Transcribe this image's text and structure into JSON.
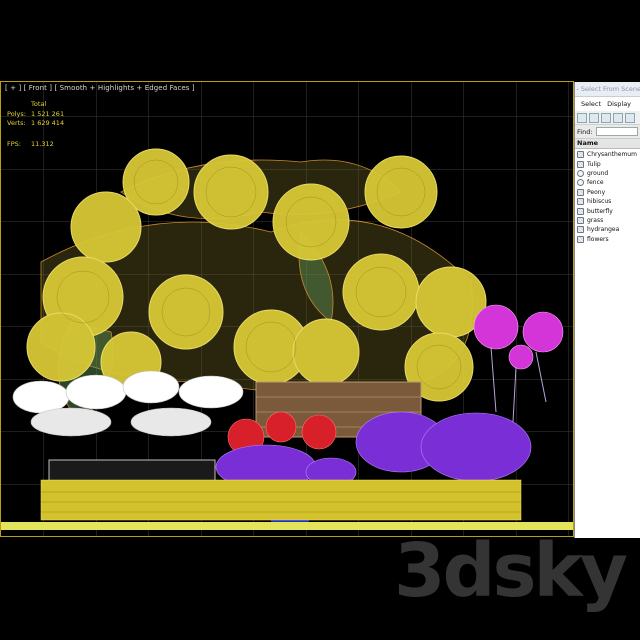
{
  "viewport": {
    "label": "[ + ] [ Front ] [ Smooth + Highlights + Edged Faces ]",
    "stats": {
      "total_label": "Total",
      "polys_label": "Polys:",
      "polys_value": "1 521 261",
      "verts_label": "Verts:",
      "verts_value": "1 629 414",
      "fps_label": "FPS:",
      "fps_value": "11.312"
    },
    "colors": {
      "frame": "#b8a012",
      "grid": "#3b3b3b",
      "hydrangea": "#d8c836",
      "leaf_wire": "#c8892a",
      "lily": "#ffffff",
      "peony": "#d8202a",
      "purple_flower": "#7a2fd6",
      "pink_chrysanthemum": "#d335d9",
      "grass": "#d3c22c",
      "ground": "#e4e45a"
    }
  },
  "panel": {
    "title": "Select From Scene",
    "menu": [
      "Select",
      "Display"
    ],
    "find_label": "Find:",
    "find_value": "",
    "column_name": "Name",
    "items": [
      {
        "label": "Chrysanthemum",
        "icon": "mesh"
      },
      {
        "label": "Tulip",
        "icon": "mesh"
      },
      {
        "label": "ground",
        "icon": "sphere"
      },
      {
        "label": "fence",
        "icon": "sphere"
      },
      {
        "label": "Peony",
        "icon": "mesh"
      },
      {
        "label": "hibiscus",
        "icon": "mesh"
      },
      {
        "label": "butterfly",
        "icon": "mesh"
      },
      {
        "label": "grass",
        "icon": "mesh"
      },
      {
        "label": "hydrangea",
        "icon": "mesh"
      },
      {
        "label": "flowers",
        "icon": "mesh"
      }
    ]
  },
  "watermark": "3dsky"
}
